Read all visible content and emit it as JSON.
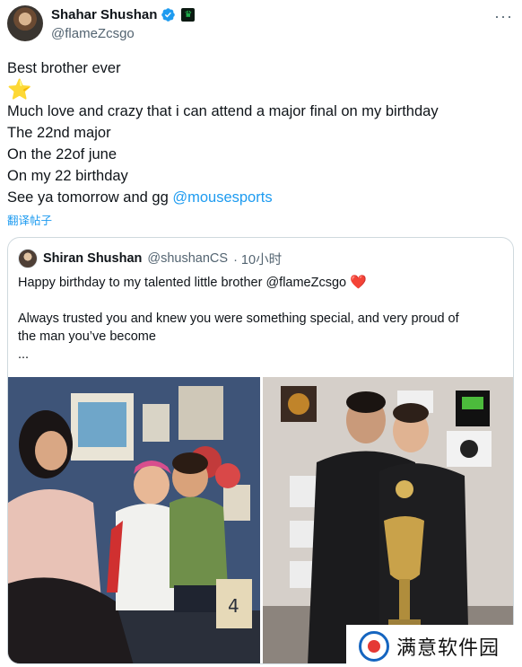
{
  "author": {
    "display_name": "Shahar Shushan",
    "handle": "@flameZcsgo",
    "more_icon": "more-horizontal-icon"
  },
  "tweet": {
    "line1": "Best brother ever",
    "line2": "⭐",
    "line3": "Much love and crazy that i can attend a major final on my birthday",
    "line4": "The 22nd major",
    "line5": "On the 22of june",
    "line6": "On my 22 birthday",
    "line7_prefix": "See ya tomorrow and gg ",
    "line7_mention": "@mousesports",
    "translate_label": "翻译帖子"
  },
  "quoted": {
    "display_name": "Shiran Shushan",
    "handle": "@shushanCS",
    "time": "· 10小时",
    "line1_text": "Happy birthday to my talented little brother @flameZcsgo",
    "line1_emoji": "❤️",
    "line2": "Always trusted you and knew you were something special, and very proud of",
    "line3": "the man you’ve become",
    "line4": "..."
  },
  "watermark": {
    "text": "满意软件园"
  },
  "colors": {
    "link": "#1d9bf0",
    "verified": "#1d9bf0",
    "heart": "#f91880"
  }
}
